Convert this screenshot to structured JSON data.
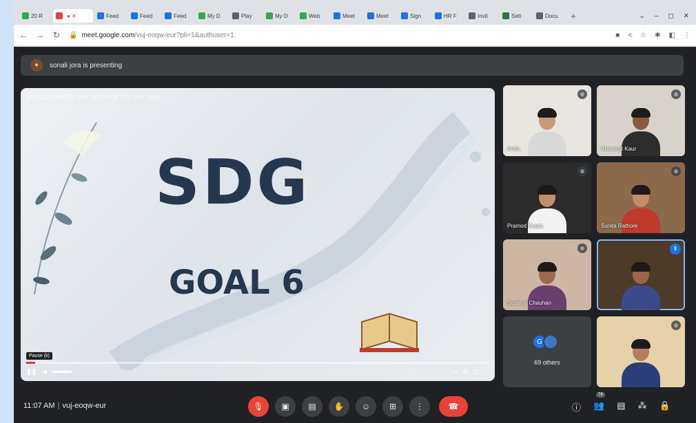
{
  "browser": {
    "tabs": [
      {
        "label": "20 R",
        "color": "#34a853"
      },
      {
        "label": "",
        "color": "#ea4335",
        "active": true
      },
      {
        "label": "Feed",
        "color": "#1a73e8"
      },
      {
        "label": "Feed",
        "color": "#1a73e8"
      },
      {
        "label": "Feed",
        "color": "#1a73e8"
      },
      {
        "label": "My D",
        "color": "#34a853"
      },
      {
        "label": "Play",
        "color": "#5f6368"
      },
      {
        "label": "My D",
        "color": "#34a853"
      },
      {
        "label": "Web",
        "color": "#34a853"
      },
      {
        "label": "Meet",
        "color": "#1a73e8"
      },
      {
        "label": "Meet",
        "color": "#1a73e8"
      },
      {
        "label": "Sign",
        "color": "#1a73e8"
      },
      {
        "label": "HR F",
        "color": "#1a73e8"
      },
      {
        "label": "Invit",
        "color": "#5f6368"
      },
      {
        "label": "Sett",
        "color": "#188038"
      },
      {
        "label": "Docu",
        "color": "#5f6368"
      }
    ],
    "new_tab": "+",
    "url_host": "meet.google.com",
    "url_path": "/vuj-eoqw-eur?pli=1&authuser=1"
  },
  "meet": {
    "presenter_text": "sonali jora is presenting",
    "video_title": "WORLD WATER DAY AND POETRY DAY.mp4",
    "slide_main": "SDG",
    "slide_sub": "GOAL 6",
    "pause_tooltip": "Pause (k)",
    "participants": [
      {
        "name": "Anita",
        "skin": "#c99a7a",
        "shirt": "#d9d9d9",
        "bg": "#e8e4df"
      },
      {
        "name": "Charanjit Kaur",
        "skin": "#8a5a3c",
        "shirt": "#2d2d2d",
        "bg": "#d7d2cc"
      },
      {
        "name": "Pramod Gupta",
        "skin": "#c28f6b",
        "shirt": "#f2f2f2",
        "bg": "#2b2b2b"
      },
      {
        "name": "Sunita Rathore",
        "skin": "#c48d6a",
        "shirt": "#c0392b",
        "bg": "#8a6a4a"
      },
      {
        "name": "Sushma Chauhan",
        "skin": "#9c6a4c",
        "shirt": "#6b3f6e",
        "bg": "#cdb7a4"
      },
      {
        "name": "",
        "skin": "#9a6848",
        "shirt": "#3a4a8a",
        "bg": "#4d3b2a",
        "active": true
      },
      {
        "name": "",
        "skin": "#b57f5d",
        "shirt": "#2a3f7a",
        "bg": "#e6d2a8"
      }
    ],
    "others_count": "69 others",
    "others_avatars": [
      {
        "letter": "G",
        "color": "#1a73e8"
      },
      {
        "letter": "",
        "color": "#3c77c9"
      }
    ],
    "time": "11:07 AM",
    "meeting_code": "vuj-eoqw-eur",
    "people_badge": "74"
  }
}
